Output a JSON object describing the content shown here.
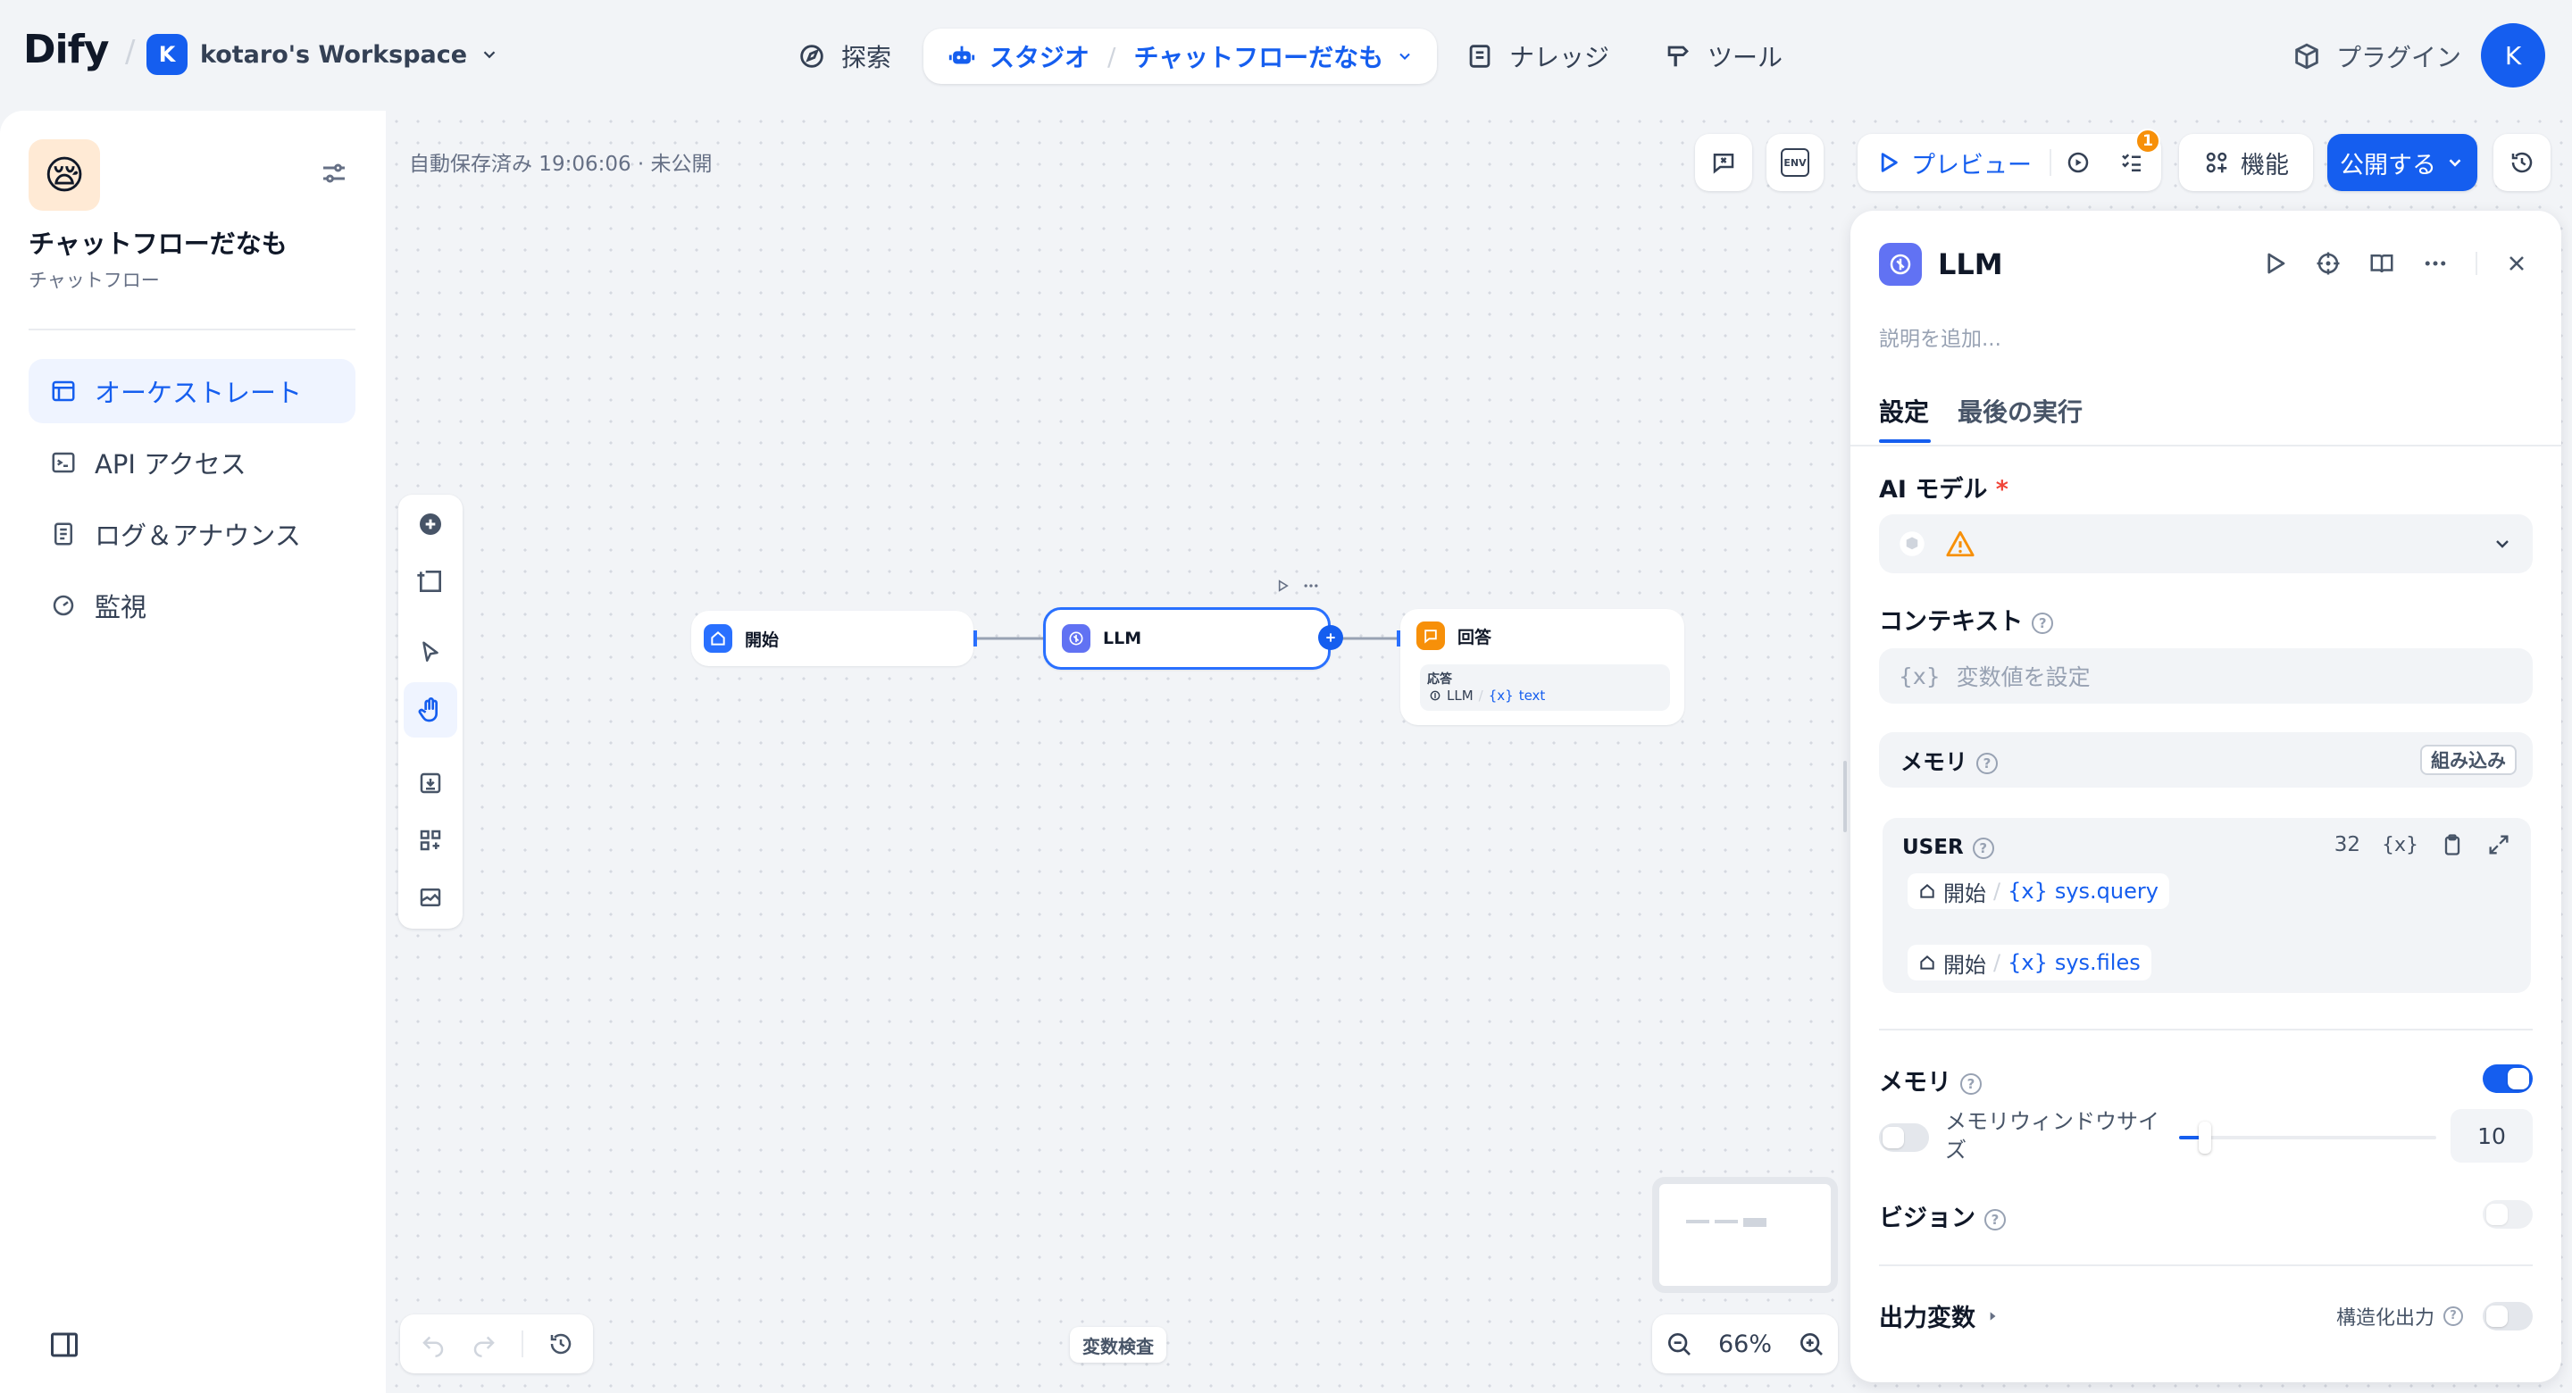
{
  "header": {
    "logo": "Dify",
    "workspace_initial": "K",
    "workspace_name": "kotaro's Workspace",
    "nav": {
      "explore": "探索",
      "studio": "スタジオ",
      "app_name": "チャットフローだなも",
      "knowledge": "ナレッジ",
      "tools": "ツール",
      "plugins": "プラグイン"
    },
    "avatar_initial": "K"
  },
  "sidebar": {
    "app_emoji": "😪",
    "app_title": "チャットフローだなも",
    "app_type": "チャットフロー",
    "items": [
      {
        "label": "オーケストレート",
        "active": true
      },
      {
        "label": "API アクセス"
      },
      {
        "label": "ログ＆アナウンス"
      },
      {
        "label": "監視"
      }
    ]
  },
  "canvas": {
    "autosave_status": "自動保存済み 19:06:06 · 未公開",
    "toolbar": {
      "env": "ENV",
      "preview": "プレビュー",
      "badge_count": "1",
      "features": "機能",
      "publish": "公開する"
    },
    "nodes": {
      "start": {
        "title": "開始"
      },
      "llm": {
        "title": "LLM"
      },
      "answer": {
        "title": "回答",
        "field_label": "応答",
        "ref_node": "LLM",
        "ref_var": "text"
      }
    },
    "inspect_button": "変数検査",
    "zoom": "66%"
  },
  "panel": {
    "title": "LLM",
    "description_placeholder": "説明を追加...",
    "tabs": {
      "settings": "設定",
      "last_run": "最後の実行"
    },
    "ai_model_label": "AI モデル",
    "required_mark": "*",
    "context_label": "コンテキスト",
    "context_placeholder": "変数値を設定",
    "var_glyph": "{x}",
    "memory_label": "メモリ",
    "builtin_badge": "組み込み",
    "user_block": {
      "role": "USER",
      "count": "32",
      "refs": [
        {
          "node": "開始",
          "sep": "/",
          "var": "sys.query"
        },
        {
          "node": "開始",
          "sep": "/",
          "var": "sys.files"
        }
      ]
    },
    "memory_toggle_label": "メモリ",
    "memory_toggle_on": true,
    "window_size_label": "メモリウィンドウサイズ",
    "window_size_value": "10",
    "window_size_level": 0.1,
    "vision_label": "ビジョン",
    "output_vars_label": "出力変数",
    "structured_output_label": "構造化出力"
  },
  "colors": {
    "accent": "#155eef",
    "warning": "#f79009",
    "llm_icon": "#6172f3",
    "start_icon": "#2970ff",
    "answer_icon": "#f79009",
    "badge": "#f79009"
  }
}
